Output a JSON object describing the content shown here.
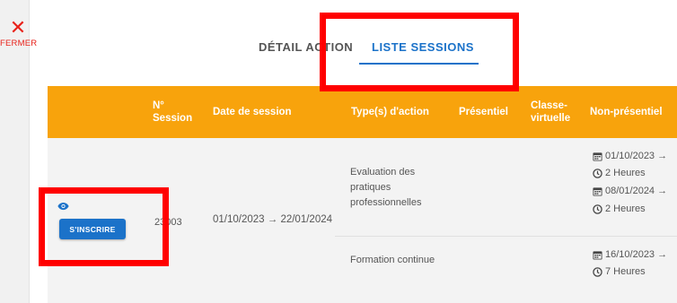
{
  "close": {
    "icon": "close-icon",
    "label": "FERMER"
  },
  "tabs": [
    {
      "label": "DÉTAIL ACTION",
      "active": false
    },
    {
      "label": "LISTE SESSIONS",
      "active": true
    }
  ],
  "colors": {
    "accent": "#1b72c9",
    "header_bg": "#f8a30c",
    "close": "#e8221b",
    "annotation": "#ff0000"
  },
  "table": {
    "headers": {
      "session_no": "N° Session",
      "date": "Date de session",
      "types": "Type(s) d'action",
      "presentiel": "Présentiel",
      "classe": "Classe-virtuelle",
      "non_presentiel": "Non-présentiel"
    },
    "row": {
      "session_no": "23003",
      "date": "01/10/2023 → 22/01/2024",
      "action_button": "S'INSCRIRE",
      "actions": [
        {
          "type": "Evaluation des pratiques professionnelles",
          "non_presentiel": [
            {
              "date": "01/10/2023 →",
              "duration": "2 Heures"
            },
            {
              "date": "08/01/2024 →",
              "duration": "2 Heures"
            }
          ]
        },
        {
          "type": "Formation continue",
          "non_presentiel": [
            {
              "date": "16/10/2023 →",
              "duration": "7 Heures"
            }
          ]
        }
      ]
    }
  }
}
